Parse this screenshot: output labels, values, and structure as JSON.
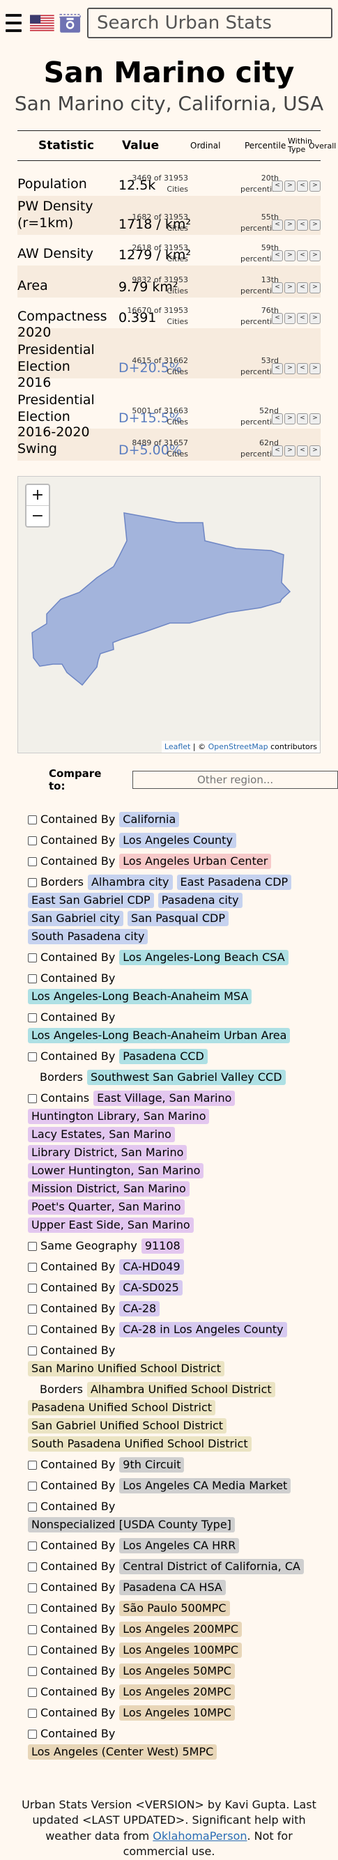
{
  "header": {
    "search_placeholder": "Search Urban Stats"
  },
  "title": "San Marino city",
  "subtitle": "San Marino city, California, USA",
  "columns": {
    "statistic": "Statistic",
    "value": "Value",
    "ordinal": "Ordinal",
    "percentile": "Percentile",
    "within_type": "Within Type",
    "overall": "Overall"
  },
  "stats": [
    {
      "name": "Population",
      "value": "12.5k",
      "ordinal": "3469 of 31953 Cities",
      "percentile": "20th percentile"
    },
    {
      "name": "PW Density (r=1km)",
      "value": "1718 / km²",
      "ordinal": "1682 of 31953 Cities",
      "percentile": "55th percentile"
    },
    {
      "name": "AW Density",
      "value": "1279 / km²",
      "ordinal": "2618 of 31953 Cities",
      "percentile": "59th percentile"
    },
    {
      "name": "Area",
      "value": "9.79 km²",
      "ordinal": "9832 of 31953 Cities",
      "percentile": "13th percentile"
    },
    {
      "name": "Compactness",
      "value": "0.391",
      "ordinal": "16670 of 31953 Cities",
      "percentile": "76th percentile"
    },
    {
      "name": "2020 Presidential Election",
      "value": "D+20.5%",
      "ordinal": "4615 of 31662 Cities",
      "percentile": "53rd percentile"
    },
    {
      "name": "2016 Presidential Election",
      "value": "D+15.5%",
      "ordinal": "5001 of 31663 Cities",
      "percentile": "52nd percentile"
    },
    {
      "name": "2016-2020 Swing",
      "value": "D+5.00%",
      "ordinal": "8489 of 31657 Cities",
      "percentile": "62nd percentile"
    }
  ],
  "map": {
    "zoom_in": "+",
    "zoom_out": "−",
    "attr_leaflet": "Leaflet",
    "attr_sep": " | © ",
    "attr_osm": "OpenStreetMap",
    "attr_tail": " contributors",
    "fill": "#a3b4dc"
  },
  "compare": {
    "label": "Compare to:",
    "placeholder": "Other region..."
  },
  "relations": [
    {
      "label": "Contained By",
      "color": "blue",
      "items": [
        "California"
      ]
    },
    {
      "label": "Contained By",
      "color": "blue",
      "items": [
        "Los Angeles County"
      ]
    },
    {
      "label": "Contained By",
      "color": "pink",
      "items": [
        "Los Angeles Urban Center"
      ]
    },
    {
      "label": "Borders",
      "color": "blue",
      "items": [
        "Alhambra city",
        "East Pasadena CDP",
        "East San Gabriel CDP",
        "Pasadena city",
        "San Gabriel city",
        "San Pasqual CDP",
        "South Pasadena city"
      ]
    },
    {
      "label": "Contained By",
      "color": "teal",
      "items": [
        "Los Angeles-Long Beach CSA"
      ]
    },
    {
      "label": "Contained By",
      "color": "teal",
      "items": [
        "Los Angeles-Long Beach-Anaheim MSA"
      ]
    },
    {
      "label": "Contained By",
      "color": "teal",
      "items": [
        "Los Angeles-Long Beach-Anaheim Urban Area"
      ]
    },
    {
      "label": "Contained By",
      "color": "teal",
      "items": [
        "Pasadena CCD"
      ]
    },
    {
      "label": "Borders",
      "color": "teal",
      "nocheck": true,
      "items": [
        "Southwest San Gabriel Valley CCD"
      ]
    },
    {
      "label": "Contains",
      "color": "purple",
      "items": [
        "East Village, San Marino",
        "Huntington Library, San Marino",
        "Lacy Estates, San Marino",
        "Library District, San Marino",
        "Lower Huntington, San Marino",
        "Mission District, San Marino",
        "Poet's Quarter, San Marino",
        "Upper East Side, San Marino"
      ]
    },
    {
      "label": "Same Geography",
      "color": "purple",
      "items": [
        "91108"
      ]
    },
    {
      "label": "Contained By",
      "color": "violet",
      "items": [
        "CA-HD049"
      ]
    },
    {
      "label": "Contained By",
      "color": "violet",
      "items": [
        "CA-SD025"
      ]
    },
    {
      "label": "Contained By",
      "color": "violet",
      "items": [
        "CA-28"
      ]
    },
    {
      "label": "Contained By",
      "color": "violet",
      "items": [
        "CA-28 in Los Angeles County"
      ]
    },
    {
      "label": "Contained By",
      "color": "olive",
      "items": [
        "San Marino Unified School District"
      ]
    },
    {
      "label": "Borders",
      "color": "olive",
      "nocheck": true,
      "items": [
        "Alhambra Unified School District",
        "Pasadena Unified School District",
        "San Gabriel Unified School District",
        "South Pasadena Unified School District"
      ]
    },
    {
      "label": "Contained By",
      "color": "gray",
      "items": [
        "9th Circuit"
      ]
    },
    {
      "label": "Contained By",
      "color": "gray",
      "items": [
        "Los Angeles CA Media Market"
      ]
    },
    {
      "label": "Contained By",
      "color": "gray",
      "items": [
        "Nonspecialized [USDA County Type]"
      ]
    },
    {
      "label": "Contained By",
      "color": "gray",
      "items": [
        "Los Angeles CA HRR"
      ]
    },
    {
      "label": "Contained By",
      "color": "gray",
      "items": [
        "Central District of California, CA"
      ]
    },
    {
      "label": "Contained By",
      "color": "gray",
      "items": [
        "Pasadena CA HSA"
      ]
    },
    {
      "label": "Contained By",
      "color": "tan",
      "items": [
        "São Paulo 500MPC"
      ]
    },
    {
      "label": "Contained By",
      "color": "tan",
      "items": [
        "Los Angeles 200MPC"
      ]
    },
    {
      "label": "Contained By",
      "color": "tan",
      "items": [
        "Los Angeles 100MPC"
      ]
    },
    {
      "label": "Contained By",
      "color": "tan",
      "items": [
        "Los Angeles 50MPC"
      ]
    },
    {
      "label": "Contained By",
      "color": "tan",
      "items": [
        "Los Angeles 20MPC"
      ]
    },
    {
      "label": "Contained By",
      "color": "tan",
      "items": [
        "Los Angeles 10MPC"
      ]
    },
    {
      "label": "Contained By",
      "color": "tan",
      "items": [
        "Los Angeles (Center West) 5MPC"
      ]
    }
  ],
  "footer": {
    "line1": "Urban Stats Version <VERSION> by Kavi Gupta. Last updated <LAST UPDATED>. Significant help with weather data from ",
    "link": "OklahomaPerson",
    "line2": ". Not for commercial use."
  }
}
